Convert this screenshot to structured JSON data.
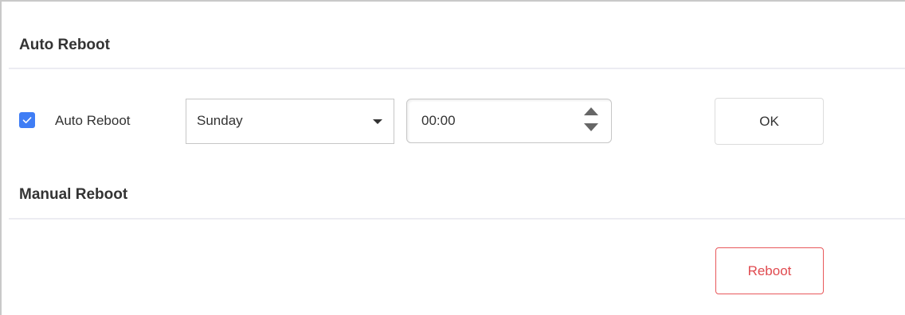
{
  "auto_reboot_section": {
    "title": "Auto Reboot",
    "checkbox_checked": true,
    "checkbox_label": "Auto Reboot",
    "day_select": {
      "value": "Sunday"
    },
    "time_input": {
      "value": "00:00"
    },
    "ok_label": "OK"
  },
  "manual_reboot_section": {
    "title": "Manual Reboot",
    "reboot_label": "Reboot"
  },
  "colors": {
    "accent": "#3f7df5",
    "danger": "#e04a4f",
    "text": "#333333"
  }
}
